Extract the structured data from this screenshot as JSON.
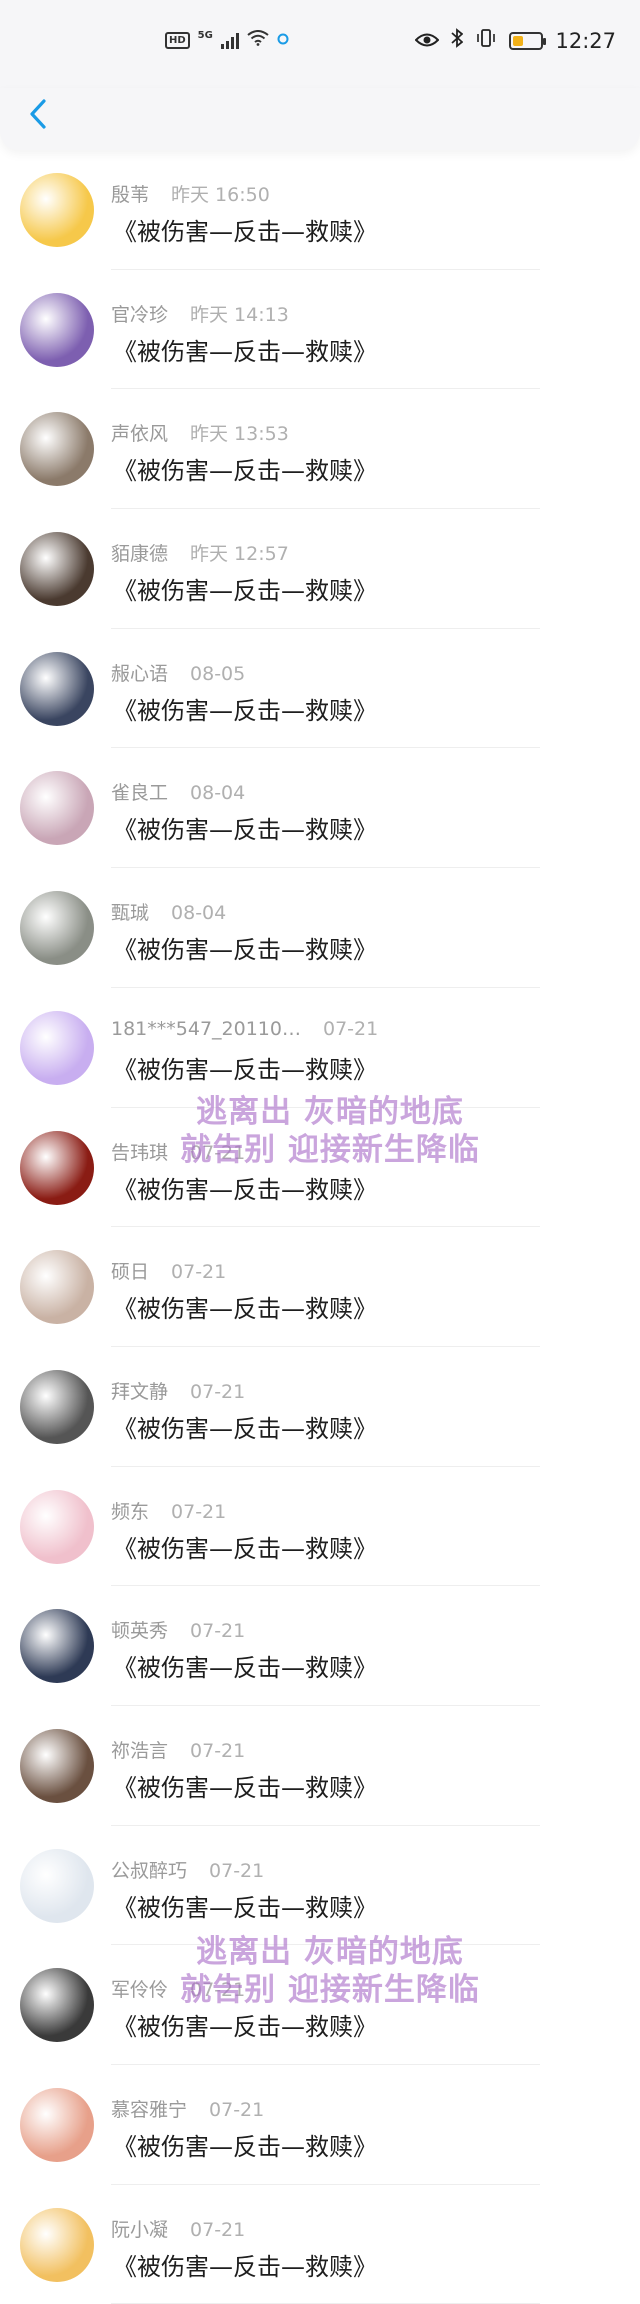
{
  "status": {
    "network_badge": "HD",
    "network_type": "5G",
    "time": "12:27"
  },
  "nav": {
    "back_icon": "chevron-left-icon",
    "accent_color": "#1a9be6"
  },
  "messages": [
    {
      "name": "殷苇",
      "time": "昨天 16:50",
      "text": "《被伤害—反击—救赎》",
      "avatar_color": "#f6c84a"
    },
    {
      "name": "官冷珍",
      "time": "昨天 14:13",
      "text": "《被伤害—反击—救赎》",
      "avatar_color": "#7d5fb0"
    },
    {
      "name": "声依风",
      "time": "昨天 13:53",
      "text": "《被伤害—反击—救赎》",
      "avatar_color": "#8b7a6a"
    },
    {
      "name": "貊康德",
      "time": "昨天 12:57",
      "text": "《被伤害—反击—救赎》",
      "avatar_color": "#4a3a30"
    },
    {
      "name": "赧心语",
      "time": "08-05",
      "text": "《被伤害—反击—救赎》",
      "avatar_color": "#3a4560"
    },
    {
      "name": "雀良工",
      "time": "08-04",
      "text": "《被伤害—反击—救赎》",
      "avatar_color": "#c9a6b6"
    },
    {
      "name": "甄珹",
      "time": "08-04",
      "text": "《被伤害—反击—救赎》",
      "avatar_color": "#8a8e86"
    },
    {
      "name": "181***547_20110…",
      "time": "07-21",
      "text": "《被伤害—反击—救赎》",
      "avatar_color": "#c8aef0"
    },
    {
      "name": "告玮琪",
      "time": "07-21",
      "text": "《被伤害—反击—救赎》",
      "avatar_color": "#8a1c14"
    },
    {
      "name": "硕日",
      "time": "07-21",
      "text": "《被伤害—反击—救赎》",
      "avatar_color": "#c9b2a4"
    },
    {
      "name": "拜文静",
      "time": "07-21",
      "text": "《被伤害—反击—救赎》",
      "avatar_color": "#555555"
    },
    {
      "name": "频东",
      "time": "07-21",
      "text": "《被伤害—反击—救赎》",
      "avatar_color": "#f0c0cc"
    },
    {
      "name": "顿英秀",
      "time": "07-21",
      "text": "《被伤害—反击—救赎》",
      "avatar_color": "#2e3a55"
    },
    {
      "name": "祢浩言",
      "time": "07-21",
      "text": "《被伤害—反击—救赎》",
      "avatar_color": "#6a5040"
    },
    {
      "name": "公叔醉巧",
      "time": "07-21",
      "text": "《被伤害—反击—救赎》",
      "avatar_color": "#dfe6ee"
    },
    {
      "name": "军伶伶",
      "time": "07-21",
      "text": "《被伤害—反击—救赎》",
      "avatar_color": "#3a3a3a"
    },
    {
      "name": "慕容雅宁",
      "time": "07-21",
      "text": "《被伤害—反击—救赎》",
      "avatar_color": "#e7a08a"
    },
    {
      "name": "阮小凝",
      "time": "07-21",
      "text": "《被伤害—反击—救赎》",
      "avatar_color": "#f2c060"
    }
  ],
  "watermark": {
    "line1": "逃离出 灰暗的地底",
    "line2": "就告别 迎接新生降临",
    "color": "#b27ad0"
  }
}
